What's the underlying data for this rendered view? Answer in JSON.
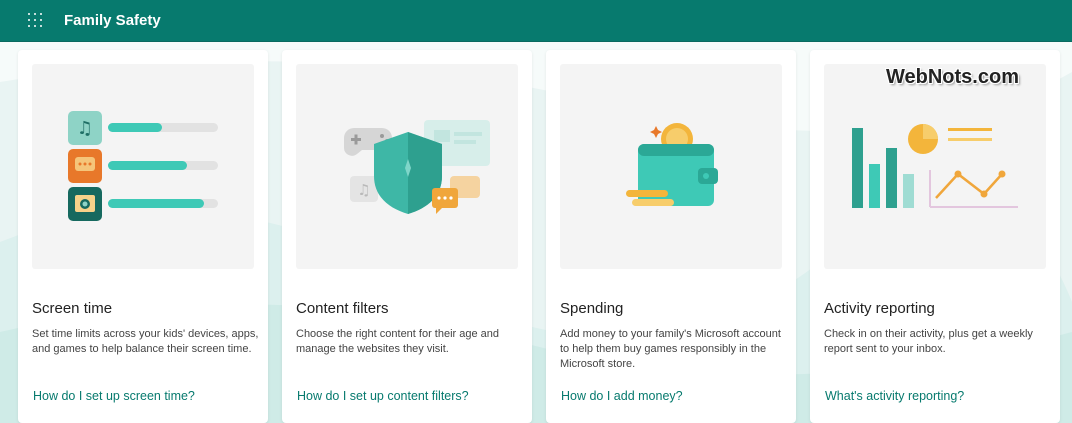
{
  "header": {
    "app_title": "Family Safety",
    "launcher_icon": "waffle-icon"
  },
  "watermark": "WebNots.com",
  "cards": [
    {
      "title": "Screen time",
      "description": "Set time limits across your kids' devices, apps, and games to help balance their screen time.",
      "link": "How do I set up screen time?"
    },
    {
      "title": "Content filters",
      "description": "Choose the right content for their age and manage the websites they visit.",
      "link": "How do I set up content filters?"
    },
    {
      "title": "Spending",
      "description": "Add money to your family's Microsoft account to help them buy games responsibly in the Microsoft store.",
      "link": "How do I add money?"
    },
    {
      "title": "Activity reporting",
      "description": "Check in on their activity, plus get a weekly report sent to your inbox.",
      "link": "What's activity reporting?"
    }
  ],
  "colors": {
    "brand": "#077a6e",
    "accent_teal": "#3ec9b6",
    "link": "#077a6e"
  }
}
